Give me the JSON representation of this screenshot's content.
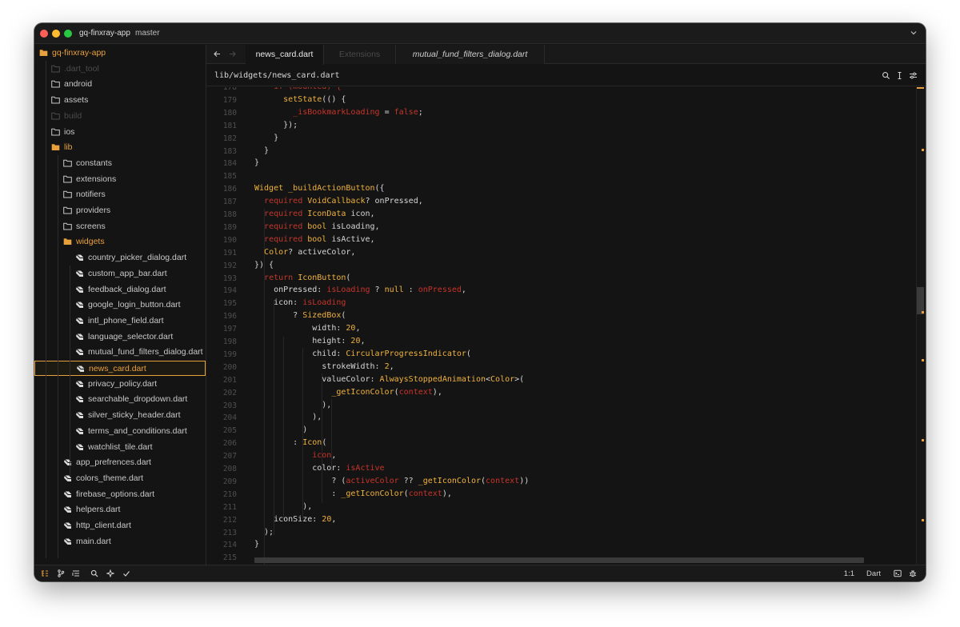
{
  "app": {
    "project_name": "gq-finxray-app",
    "branch": "master"
  },
  "sidebar": {
    "root": "gq-finxray-app",
    "folders_top": [
      ".dart_tool",
      "android",
      "assets",
      "build",
      "ios"
    ],
    "lib": "lib",
    "lib_folders": [
      "constants",
      "extensions",
      "notifiers",
      "providers",
      "screens"
    ],
    "widgets": "widgets",
    "widget_files": [
      "country_picker_dialog.dart",
      "custom_app_bar.dart",
      "feedback_dialog.dart",
      "google_login_button.dart",
      "intl_phone_field.dart",
      "language_selector.dart",
      "mutual_fund_filters_dialog.dart",
      "news_card.dart",
      "privacy_policy.dart",
      "searchable_dropdown.dart",
      "silver_sticky_header.dart",
      "terms_and_conditions.dart",
      "watchlist_tile.dart"
    ],
    "lib_files": [
      "app_prefrences.dart",
      "colors_theme.dart",
      "firebase_options.dart",
      "helpers.dart",
      "http_client.dart",
      "main.dart"
    ]
  },
  "tabs": [
    {
      "label": "news_card.dart",
      "state": "active"
    },
    {
      "label": "Extensions",
      "state": "inactive"
    },
    {
      "label": "mutual_fund_filters_dialog.dart",
      "state": "preview"
    }
  ],
  "path": "lib/widgets/news_card.dart",
  "editor": {
    "line_numbers": [
      "178",
      "179",
      "180",
      "181",
      "182",
      "183",
      "184",
      "185",
      "186",
      "187",
      "188",
      "189",
      "190",
      "191",
      "192",
      "193",
      "194",
      "195",
      "196",
      "197",
      "198",
      "199",
      "200",
      "201",
      "202",
      "203",
      "204",
      "205",
      "206",
      "207",
      "208",
      "209",
      "210",
      "211",
      "212",
      "213",
      "214",
      "215"
    ],
    "lines": [
      [
        [
          "    ",
          "p"
        ],
        [
          "if (mounted) {",
          "kw"
        ]
      ],
      [
        [
          "      ",
          "p"
        ],
        [
          "setState",
          "fn"
        ],
        [
          "(() {",
          "p"
        ]
      ],
      [
        [
          "        ",
          "p"
        ],
        [
          "_isBookmarkLoading",
          "var"
        ],
        [
          " = ",
          "p"
        ],
        [
          "false",
          "kw"
        ],
        [
          ";",
          "p"
        ]
      ],
      [
        [
          "      });",
          "p"
        ]
      ],
      [
        [
          "    }",
          "p"
        ]
      ],
      [
        [
          "  }",
          "p"
        ]
      ],
      [
        [
          "}",
          "p"
        ]
      ],
      [
        [
          "",
          "p"
        ]
      ],
      [
        [
          "Widget",
          "type"
        ],
        [
          " ",
          "p"
        ],
        [
          "_buildActionButton",
          "fn"
        ],
        [
          "({",
          "p"
        ]
      ],
      [
        [
          "  ",
          "p"
        ],
        [
          "required",
          "kw"
        ],
        [
          " ",
          "p"
        ],
        [
          "VoidCallback",
          "type"
        ],
        [
          "? onPressed,",
          "p"
        ]
      ],
      [
        [
          "  ",
          "p"
        ],
        [
          "required",
          "kw"
        ],
        [
          " ",
          "p"
        ],
        [
          "IconData",
          "type"
        ],
        [
          " icon,",
          "p"
        ]
      ],
      [
        [
          "  ",
          "p"
        ],
        [
          "required",
          "kw"
        ],
        [
          " ",
          "p"
        ],
        [
          "bool",
          "type"
        ],
        [
          " isLoading,",
          "p"
        ]
      ],
      [
        [
          "  ",
          "p"
        ],
        [
          "required",
          "kw"
        ],
        [
          " ",
          "p"
        ],
        [
          "bool",
          "type"
        ],
        [
          " isActive,",
          "p"
        ]
      ],
      [
        [
          "  ",
          "p"
        ],
        [
          "Color",
          "type"
        ],
        [
          "? activeColor,",
          "p"
        ]
      ],
      [
        [
          "}) {",
          "p"
        ]
      ],
      [
        [
          "  ",
          "p"
        ],
        [
          "return",
          "kw"
        ],
        [
          " ",
          "p"
        ],
        [
          "IconButton",
          "fn"
        ],
        [
          "(",
          "p"
        ]
      ],
      [
        [
          "    onPressed: ",
          "p"
        ],
        [
          "isLoading",
          "var"
        ],
        [
          " ? ",
          "p"
        ],
        [
          "null",
          "type"
        ],
        [
          " : ",
          "p"
        ],
        [
          "onPressed",
          "var"
        ],
        [
          ",",
          "p"
        ]
      ],
      [
        [
          "    icon: ",
          "p"
        ],
        [
          "isLoading",
          "var"
        ]
      ],
      [
        [
          "        ? ",
          "p"
        ],
        [
          "SizedBox",
          "fn"
        ],
        [
          "(",
          "p"
        ]
      ],
      [
        [
          "            width: ",
          "p"
        ],
        [
          "20",
          "num"
        ],
        [
          ",",
          "p"
        ]
      ],
      [
        [
          "            height: ",
          "p"
        ],
        [
          "20",
          "num"
        ],
        [
          ",",
          "p"
        ]
      ],
      [
        [
          "            child: ",
          "p"
        ],
        [
          "CircularProgressIndicator",
          "fn"
        ],
        [
          "(",
          "p"
        ]
      ],
      [
        [
          "              strokeWidth: ",
          "p"
        ],
        [
          "2",
          "num"
        ],
        [
          ",",
          "p"
        ]
      ],
      [
        [
          "              valueColor: ",
          "p"
        ],
        [
          "AlwaysStoppedAnimation",
          "fn"
        ],
        [
          "<",
          "p"
        ],
        [
          "Color",
          "type"
        ],
        [
          ">(",
          "p"
        ]
      ],
      [
        [
          "                ",
          "p"
        ],
        [
          "_getIconColor",
          "fn"
        ],
        [
          "(",
          "p"
        ],
        [
          "context",
          "var"
        ],
        [
          "),",
          "p"
        ]
      ],
      [
        [
          "              ),",
          "p"
        ]
      ],
      [
        [
          "            ),",
          "p"
        ]
      ],
      [
        [
          "          )",
          "p"
        ]
      ],
      [
        [
          "        : ",
          "p"
        ],
        [
          "Icon",
          "fn"
        ],
        [
          "(",
          "p"
        ]
      ],
      [
        [
          "            ",
          "p"
        ],
        [
          "icon",
          "var"
        ],
        [
          ",",
          "p"
        ]
      ],
      [
        [
          "            color: ",
          "p"
        ],
        [
          "isActive",
          "var"
        ]
      ],
      [
        [
          "                ? (",
          "p"
        ],
        [
          "activeColor",
          "var"
        ],
        [
          " ?? ",
          "p"
        ],
        [
          "_getIconColor",
          "fn"
        ],
        [
          "(",
          "p"
        ],
        [
          "context",
          "var"
        ],
        [
          "))",
          "p"
        ]
      ],
      [
        [
          "                : ",
          "p"
        ],
        [
          "_getIconColor",
          "fn"
        ],
        [
          "(",
          "p"
        ],
        [
          "context",
          "var"
        ],
        [
          "),",
          "p"
        ]
      ],
      [
        [
          "          ),",
          "p"
        ]
      ],
      [
        [
          "    iconSize: ",
          "p"
        ],
        [
          "20",
          "num"
        ],
        [
          ",",
          "p"
        ]
      ],
      [
        [
          "  );",
          "p"
        ]
      ],
      [
        [
          "}",
          "p"
        ]
      ],
      [
        [
          "",
          "p"
        ]
      ]
    ]
  },
  "status": {
    "cursor": "1:1",
    "language": "Dart"
  },
  "colors": {
    "accent": "#e8a03c",
    "keyword": "#c0392b",
    "type": "#f0b23e",
    "variable": "#c8342a",
    "background": "#141414"
  }
}
